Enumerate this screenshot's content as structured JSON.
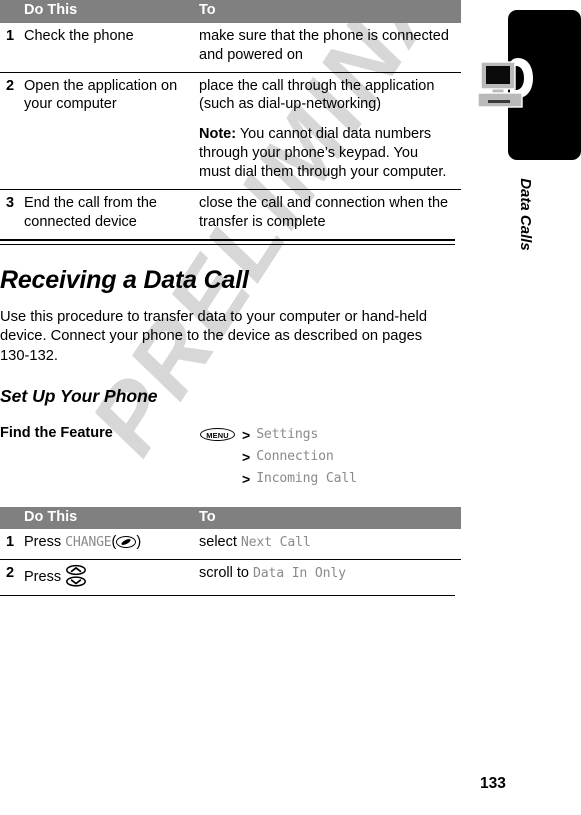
{
  "chapter": {
    "label": "Data Calls",
    "icon": "computer-phone-icon",
    "page_number": "133"
  },
  "watermark": {
    "text": "PRELIMINARY",
    "color": "#d7d7d7"
  },
  "table_top": {
    "headers": {
      "step": "",
      "do_this": "Do This",
      "to": "To"
    },
    "rows": [
      {
        "step": "1",
        "do_this": "Check the phone",
        "to": "make sure that the phone is connected and powered on",
        "note_lead": "",
        "note_text": ""
      },
      {
        "step": "2",
        "do_this": "Open the application on your computer",
        "to": "place the call through the application (such as dial-up-networking)",
        "note_lead": "Note:",
        "note_text": " You cannot dial data numbers through your phone’s keypad. You must dial them through your computer."
      },
      {
        "step": "3",
        "do_this": "End the call from the connected device",
        "to": "close the call and connection when the transfer is complete",
        "note_lead": "",
        "note_text": ""
      }
    ]
  },
  "section": {
    "title": "Receiving a Data Call",
    "paragraph": "Use this procedure to transfer data to your computer or hand-held device. Connect your phone to the device as described on pages 130-132.",
    "subtitle": "Set Up Your Phone"
  },
  "find_the_feature": {
    "label": "Find the Feature",
    "menu_key": "MENU",
    "separator": ">",
    "path": [
      "Settings",
      "Connection",
      "Incoming Call"
    ]
  },
  "table_bottom": {
    "headers": {
      "step": "",
      "do_this": "Do This",
      "to": "To"
    },
    "rows": [
      {
        "step": "1",
        "action_verb": "Press",
        "key_label": "CHANGE",
        "key_icon": "softkey-left-icon",
        "paren_open": "(",
        "paren_close": ")",
        "to_verb": "select",
        "to_value": "Next Call"
      },
      {
        "step": "2",
        "action_verb": "Press",
        "key_label": "",
        "key_icon": "scroll-updown-icon",
        "paren_open": "",
        "paren_close": "",
        "to_verb": "scroll to",
        "to_value": "Data In Only"
      }
    ]
  }
}
